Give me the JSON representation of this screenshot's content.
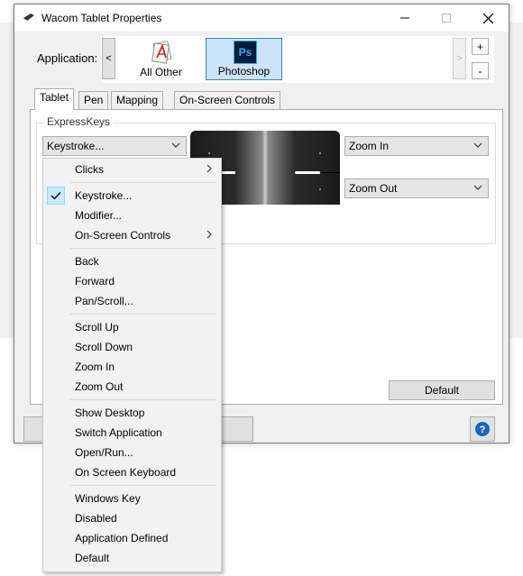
{
  "window": {
    "title": "Wacom Tablet Properties"
  },
  "application": {
    "label": "Application:",
    "left_arrow": "<",
    "right_arrow": ">",
    "tiles": [
      {
        "label": "All Other",
        "icon": "all-other-icon",
        "selected": false
      },
      {
        "label": "Photoshop",
        "icon": "photoshop-icon",
        "icon_text": "Ps",
        "selected": true
      }
    ],
    "add": "+",
    "remove": "-"
  },
  "tabs": [
    {
      "label": "Tablet",
      "active": true
    },
    {
      "label": "Pen",
      "active": false
    },
    {
      "label": "Mapping",
      "active": false
    },
    {
      "label": "On-Screen Controls",
      "active": false
    }
  ],
  "expresskeys": {
    "group_title": "ExpressKeys",
    "main_combo": "Keystroke...",
    "right_top_combo": "Zoom In",
    "right_bottom_combo": "Zoom Out"
  },
  "buttons": {
    "default": "Default",
    "help": "?"
  },
  "menu": {
    "items": [
      {
        "label": "Clicks",
        "submenu": true,
        "checked": false
      },
      {
        "label": "Keystroke...",
        "submenu": false,
        "checked": true
      },
      {
        "label": "Modifier...",
        "submenu": false,
        "checked": false
      },
      {
        "label": "On-Screen Controls",
        "submenu": true,
        "checked": false
      },
      {
        "label": "Back",
        "submenu": false,
        "checked": false
      },
      {
        "label": "Forward",
        "submenu": false,
        "checked": false
      },
      {
        "label": "Pan/Scroll...",
        "submenu": false,
        "checked": false
      },
      {
        "label": "Scroll Up",
        "submenu": false,
        "checked": false
      },
      {
        "label": "Scroll Down",
        "submenu": false,
        "checked": false
      },
      {
        "label": "Zoom In",
        "submenu": false,
        "checked": false
      },
      {
        "label": "Zoom Out",
        "submenu": false,
        "checked": false
      },
      {
        "label": "Show Desktop",
        "submenu": false,
        "checked": false
      },
      {
        "label": "Switch Application",
        "submenu": false,
        "checked": false
      },
      {
        "label": "Open/Run...",
        "submenu": false,
        "checked": false
      },
      {
        "label": "On Screen Keyboard",
        "submenu": false,
        "checked": false
      },
      {
        "label": "Windows Key",
        "submenu": false,
        "checked": false
      },
      {
        "label": "Disabled",
        "submenu": false,
        "checked": false
      },
      {
        "label": "Application Defined",
        "submenu": false,
        "checked": false
      },
      {
        "label": "Default",
        "submenu": false,
        "checked": false
      }
    ]
  },
  "colors": {
    "accent": "#cce4f7",
    "check_highlight": "#cce8ff",
    "photoshop_bg": "#001e36",
    "photoshop_fg": "#31a8ff"
  }
}
